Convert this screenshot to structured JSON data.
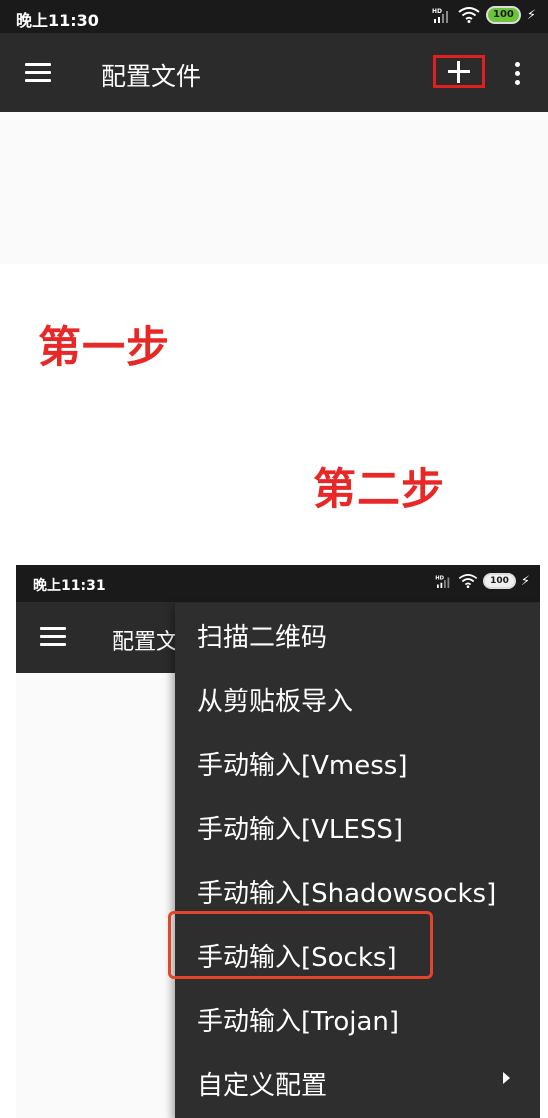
{
  "screen1": {
    "status": {
      "time": "晚上11:30",
      "hd": "HD",
      "battery": "100"
    },
    "appbar": {
      "title": "配置文件",
      "add_icon": "plus-icon",
      "menu_icon": "hamburger-icon",
      "overflow_icon": "more-vert-icon"
    }
  },
  "annotations": {
    "step1": "第一步",
    "step2": "第二步",
    "highlight_color": "#e02020",
    "step_color": "#e82727"
  },
  "screen2": {
    "status": {
      "time": "晚上11:31",
      "hd": "HD",
      "battery": "100"
    },
    "appbar": {
      "title": "配置文"
    },
    "menu": {
      "items": [
        {
          "label": "扫描二维码"
        },
        {
          "label": "从剪贴板导入"
        },
        {
          "label": "手动输入[Vmess]"
        },
        {
          "label": "手动输入[VLESS]"
        },
        {
          "label": "手动输入[Shadowsocks]"
        },
        {
          "label": "手动输入[Socks]"
        },
        {
          "label": "手动输入[Trojan]"
        },
        {
          "label": "自定义配置"
        }
      ],
      "highlighted_item": "手动输入[Socks]"
    }
  }
}
